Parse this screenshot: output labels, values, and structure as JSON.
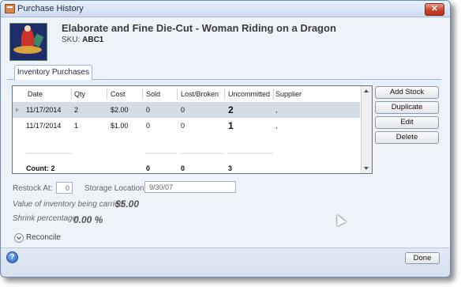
{
  "window": {
    "title": "Purchase History",
    "close_label": "✕"
  },
  "product": {
    "title": "Elaborate and Fine Die-Cut - Woman Riding on a Dragon",
    "sku_label": "SKU:",
    "sku": "ABC1"
  },
  "tabs": [
    {
      "label": "Inventory Purchases"
    }
  ],
  "grid": {
    "columns": [
      "Date",
      "Qty",
      "Cost",
      "Sold",
      "Lost/Broken",
      "Uncommitted",
      "Supplier"
    ],
    "rows": [
      [
        "11/17/2014",
        "2",
        "$2.00",
        "0",
        "0",
        "2",
        ","
      ],
      [
        "11/17/2014",
        "1",
        "$1.00",
        "0",
        "0",
        "1",
        ","
      ]
    ],
    "totals": {
      "count": "Count: 2",
      "sold": "0",
      "lost": "0",
      "uncommitted": "3"
    }
  },
  "actions": {
    "add_stock": "Add Stock",
    "duplicate": "Duplicate",
    "edit": "Edit",
    "delete": "Delete"
  },
  "restock": {
    "label": "Restock At:",
    "value": "0"
  },
  "storage": {
    "label": "Storage Location:",
    "value": "9/30/07"
  },
  "inventory_value": {
    "label": "Value of inventory being carried:",
    "value": "$5.00"
  },
  "shrink": {
    "label": "Shrink percentage:",
    "value": "0.00 %"
  },
  "reconcile": {
    "label": "Reconcile"
  },
  "footer": {
    "help_label": "?",
    "done_label": "Done"
  },
  "colors": {
    "selected_row": "#d4dce6",
    "window_bg": "#eef3fa",
    "close_button": "#c5442b"
  }
}
